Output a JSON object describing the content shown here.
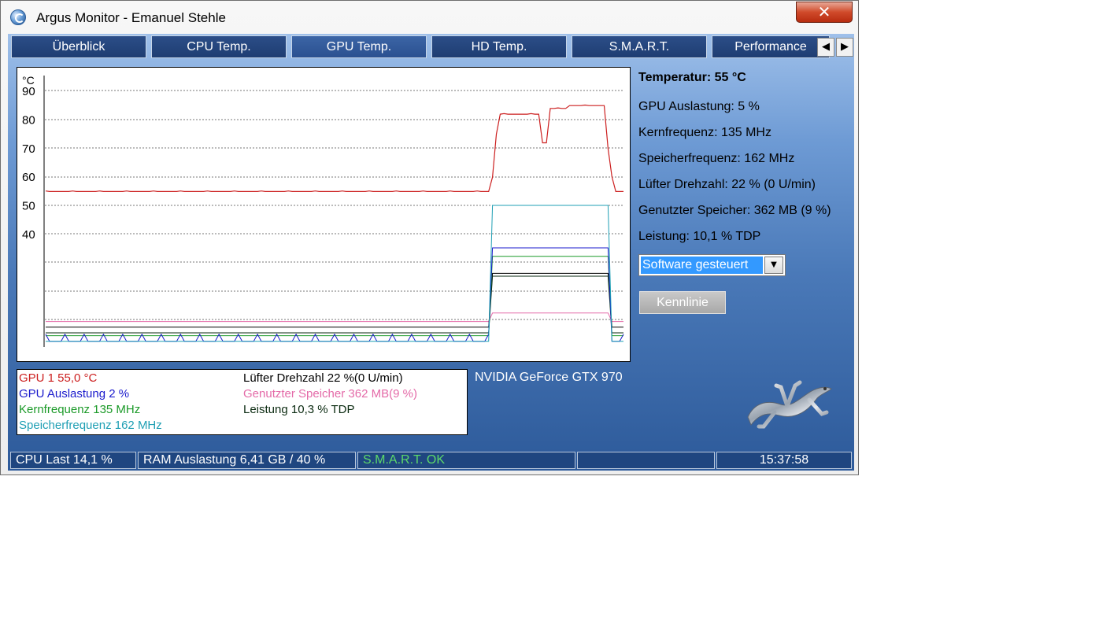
{
  "window": {
    "title": "Argus Monitor - Emanuel Stehle",
    "close_symbol": "✕"
  },
  "tabs": [
    {
      "label": "Überblick"
    },
    {
      "label": "CPU Temp."
    },
    {
      "label": "GPU Temp."
    },
    {
      "label": "HD Temp."
    },
    {
      "label": "S.M.A.R.T."
    },
    {
      "label": "Performance"
    }
  ],
  "active_tab": "GPU Temp.",
  "tab_scroll": {
    "left": "◀",
    "right": "▶"
  },
  "colors": {
    "temp": "#cc1f1f",
    "load": "#1a1acc",
    "core": "#1b9a28",
    "mem": "#1f9fb4",
    "fan": "#000000",
    "vram": "#e46aa8",
    "power": "#0a2a10"
  },
  "chart_data": {
    "type": "line",
    "unit": "°C",
    "y_ticks": [
      "90",
      "80",
      "70",
      "60",
      "50",
      "40"
    ],
    "ylim": [
      0,
      90
    ],
    "x_points": 150,
    "series": [
      {
        "name": "GPU 1",
        "values_segments": [
          {
            "from": 0,
            "to": 115,
            "value": 55
          },
          {
            "from": 118,
            "to": 123,
            "value": 82
          },
          {
            "from": 124,
            "to": 128,
            "value": 82
          },
          {
            "from": 129,
            "to": 130,
            "value": 72
          },
          {
            "from": 131,
            "to": 135,
            "value": 84
          },
          {
            "from": 136,
            "to": 145,
            "value": 85
          },
          {
            "from": 146,
            "to": 150,
            "value": 55
          }
        ]
      },
      {
        "name": "GPU Auslastung",
        "idle_percent": 2,
        "load_percent": 35
      },
      {
        "name": "Kernfrequenz",
        "idle_percent": 4,
        "load_percent": 32
      },
      {
        "name": "Speicherfrequenz",
        "idle_percent": 2,
        "load_percent": 50
      },
      {
        "name": "Lüfter Drehzahl",
        "idle_percent": 7,
        "load_percent": 26
      },
      {
        "name": "Genutzter Speicher",
        "idle_percent": 9,
        "load_percent": 12
      },
      {
        "name": "Leistung",
        "idle_percent": 5,
        "load_percent": 25
      }
    ]
  },
  "legend": {
    "gpu1": "GPU 1  55,0 °C",
    "load": "GPU Auslastung  2 %",
    "core": "Kernfrequenz  135 MHz",
    "mem": "Speicherfrequenz  162 MHz",
    "fan": "Lüfter Drehzahl  22 %(0 U/min)",
    "vram": "Genutzter Speicher  362 MB(9 %)",
    "power": "Leistung  10,3 % TDP"
  },
  "gpu_name": "NVIDIA GeForce GTX 970",
  "info": {
    "temperature": "Temperatur: 55 °C",
    "load": "GPU Auslastung: 5 %",
    "core": "Kernfrequenz: 135 MHz",
    "mem": "Speicherfrequenz: 162 MHz",
    "fan": "Lüfter Drehzahl: 22 % (0 U/min)",
    "vram": "Genutzter Speicher: 362 MB (9 %)",
    "power": "Leistung: 10,1 % TDP"
  },
  "fan_control": {
    "selected": "Software gesteuert",
    "arrow": "▼"
  },
  "button_curve": "Kennlinie",
  "logo_icon": "salamander-logo",
  "statusbar": {
    "cpu": "CPU Last 14,1 %",
    "ram": "RAM Auslastung 6,41 GB / 40 %",
    "smart": "S.M.A.R.T. OK",
    "empty": "",
    "clock": "15:37:58"
  }
}
